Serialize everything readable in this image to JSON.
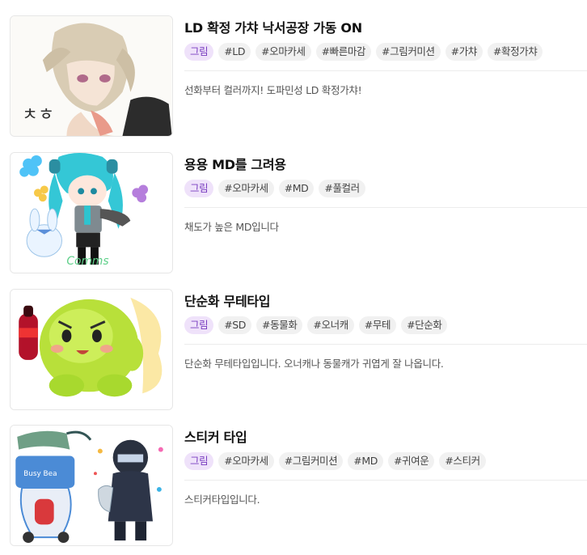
{
  "items": [
    {
      "title": "LD 확정 가챠 낙서공장 가동 ON",
      "category": "그림",
      "tags": [
        "#LD",
        "#오마카세",
        "#빠른마감",
        "#그림커미션",
        "#가챠",
        "#확정가챠"
      ],
      "description": "선화부터 컬러까지! 도파민성 LD 확정가챠!",
      "image_icon": "anime-character-sketch-icon"
    },
    {
      "title": "용용 MD를 그려용",
      "category": "그림",
      "tags": [
        "#오마카세",
        "#MD",
        "#풀컬러"
      ],
      "description": "채도가 높은 MD입니다",
      "image_icon": "chibi-character-icon"
    },
    {
      "title": "단순화 무테타입",
      "category": "그림",
      "tags": [
        "#SD",
        "#동물화",
        "#오너캐",
        "#무테",
        "#단순화"
      ],
      "description": "단순화 무테타입입니다. 오너캐나 동물캐가 귀엽게 잘 나옵니다.",
      "image_icon": "green-blob-character-icon"
    },
    {
      "title": "스티커 타입",
      "category": "그림",
      "tags": [
        "#오마카세",
        "#그림커미션",
        "#MD",
        "#귀여운",
        "#스티커"
      ],
      "description": "스티커타입입니다.",
      "image_icon": "sticker-illustration-icon"
    }
  ]
}
